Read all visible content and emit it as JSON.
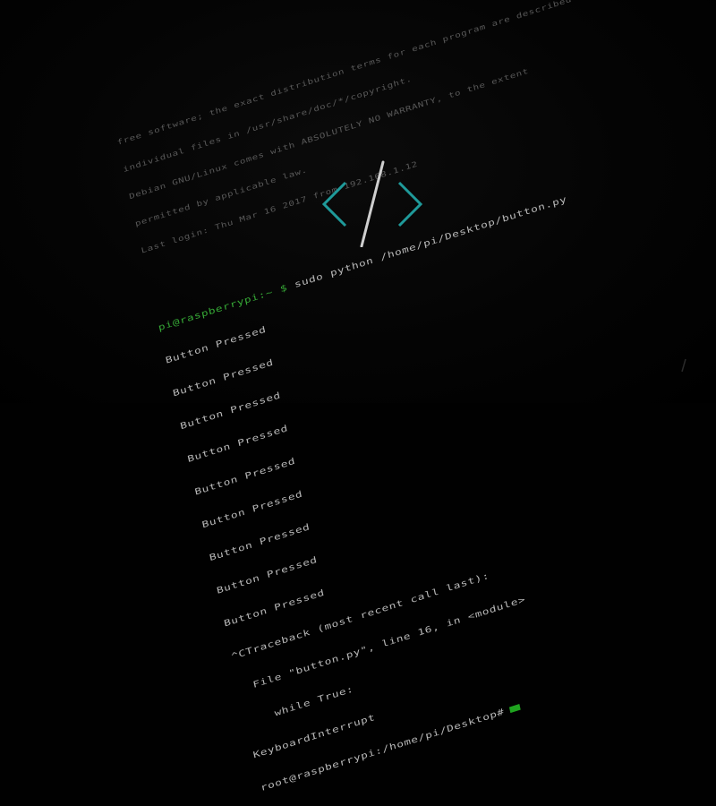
{
  "terminal": {
    "header_lines": [
      "free software; the exact distribution terms for each program are described in the",
      "individual files in /usr/share/doc/*/copyright.",
      "Debian GNU/Linux comes with ABSOLUTELY NO WARRANTY, to the extent",
      "permitted by applicable law.",
      "Last login: Thu Mar 16 2017 from 192.168.1.12"
    ],
    "command_prompt": "pi@raspberrypi:~ $",
    "command": "sudo python /home/pi/Desktop/button.py",
    "pressed_lines": [
      "Button Pressed",
      "Button Pressed",
      "Button Pressed",
      "Button Pressed",
      "Button Pressed",
      "Button Pressed",
      "Button Pressed",
      "Button Pressed",
      "Button Pressed"
    ],
    "traceback_line": "^CTraceback (most recent call last):",
    "file_line": "  File \"button.py\", line 16, in <module>",
    "while_line": "    while True:",
    "interrupt_line": "KeyboardInterrupt",
    "final_prompt": "root@raspberrypi:/home/pi/Desktop#"
  },
  "colors": {
    "background": "#010101",
    "terminal_text": "#9a9a9a",
    "prompt_green": "#36a836",
    "cursor_green": "#1fa31f",
    "logo_teal": "#1f9a9a",
    "logo_slash": "#cfcfcf"
  },
  "icons": {
    "logo": "code-brackets-icon"
  }
}
